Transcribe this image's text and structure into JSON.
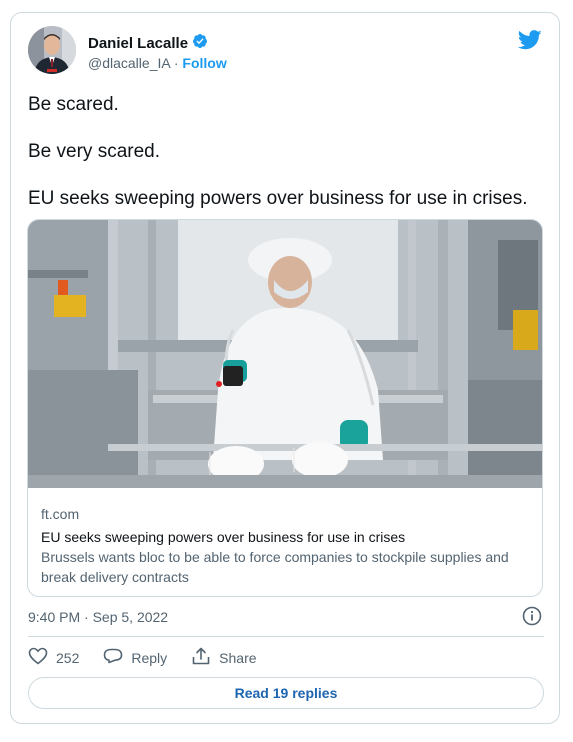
{
  "author": {
    "name": "Daniel Lacalle",
    "handle": "@dlacalle_IA",
    "separator": "·",
    "follow_label": "Follow",
    "verified": true
  },
  "tweet": {
    "lines": [
      "Be scared.",
      "Be very scared.",
      "EU seeks sweeping powers over business for use in crises."
    ],
    "timestamp": "9:40 PM · Sep 5, 2022"
  },
  "link_card": {
    "domain": "ft.com",
    "title": "EU seeks sweeping powers over business for use in crises",
    "description": "Brussels wants bloc to be able to force companies to stockpile supplies and break delivery contracts"
  },
  "actions": {
    "like_count": "252",
    "reply_label": "Reply",
    "share_label": "Share",
    "read_replies_label": "Read 19 replies"
  },
  "colors": {
    "accent": "#1d9bf0",
    "text": "#0f1419",
    "muted": "#536471",
    "border": "#cfd9de"
  },
  "icons": [
    "twitter-bird-icon",
    "verified-badge-icon",
    "info-icon",
    "heart-icon",
    "reply-icon",
    "share-icon"
  ]
}
